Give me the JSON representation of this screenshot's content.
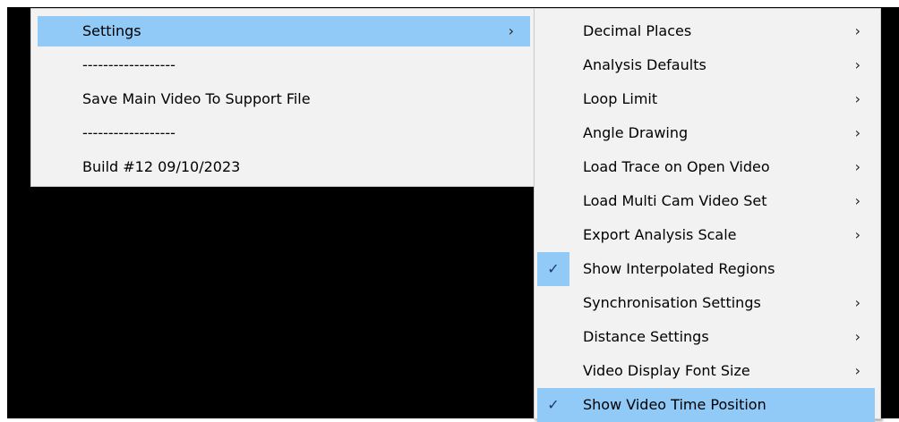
{
  "parent_menu": {
    "items": [
      {
        "label": "Settings",
        "submenu": true,
        "highlighted": true
      },
      {
        "label": "------------------",
        "submenu": false,
        "highlighted": false
      },
      {
        "label": "Save Main Video To Support File",
        "submenu": false,
        "highlighted": false
      },
      {
        "label": "------------------",
        "submenu": false,
        "highlighted": false
      },
      {
        "label": "Build #12 09/10/2023",
        "submenu": false,
        "highlighted": false
      }
    ],
    "submenu_arrow": "›"
  },
  "settings_submenu": {
    "items": [
      {
        "label": "Decimal Places",
        "submenu": true,
        "checked": false,
        "highlighted": false
      },
      {
        "label": "Analysis Defaults",
        "submenu": true,
        "checked": false,
        "highlighted": false
      },
      {
        "label": "Loop Limit",
        "submenu": true,
        "checked": false,
        "highlighted": false
      },
      {
        "label": "Angle Drawing",
        "submenu": true,
        "checked": false,
        "highlighted": false
      },
      {
        "label": "Load Trace on Open Video",
        "submenu": true,
        "checked": false,
        "highlighted": false
      },
      {
        "label": "Load Multi Cam Video Set",
        "submenu": true,
        "checked": false,
        "highlighted": false
      },
      {
        "label": "Export Analysis Scale",
        "submenu": true,
        "checked": false,
        "highlighted": false
      },
      {
        "label": "Show Interpolated Regions",
        "submenu": false,
        "checked": true,
        "highlighted": false
      },
      {
        "label": "Synchronisation Settings",
        "submenu": true,
        "checked": false,
        "highlighted": false
      },
      {
        "label": "Distance Settings",
        "submenu": true,
        "checked": false,
        "highlighted": false
      },
      {
        "label": "Video Display Font Size",
        "submenu": true,
        "checked": false,
        "highlighted": false
      },
      {
        "label": "Show Video Time Position",
        "submenu": false,
        "checked": true,
        "highlighted": true
      }
    ],
    "check_glyph": "✓",
    "submenu_arrow": "›"
  },
  "colors": {
    "menu_background": "#f2f2f2",
    "highlight": "#91c9f7",
    "backdrop": "#000000"
  }
}
